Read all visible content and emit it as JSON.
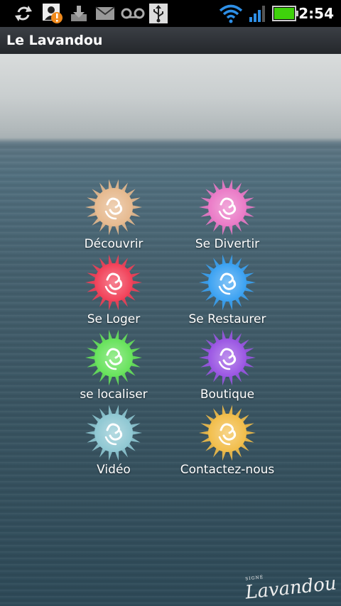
{
  "status_bar": {
    "time": "2:54",
    "icons": [
      "sync-icon",
      "account-alert-icon",
      "download-icon",
      "email-icon",
      "voicemail-icon",
      "usb-icon",
      "wifi-icon",
      "signal-icon",
      "battery-icon"
    ],
    "battery_color": "#3fd20c"
  },
  "title_bar": {
    "title": "Le Lavandou"
  },
  "menu": {
    "items": [
      {
        "label": "Découvrir",
        "color": "#e6b98e",
        "icon": "sun-logo-icon"
      },
      {
        "label": "Se Divertir",
        "color": "#ea79c6",
        "icon": "sun-logo-icon"
      },
      {
        "label": "Se Loger",
        "color": "#f13f57",
        "icon": "sun-logo-icon"
      },
      {
        "label": "Se Restaurer",
        "color": "#3aa1f2",
        "icon": "sun-logo-icon"
      },
      {
        "label": "se localiser",
        "color": "#66e25a",
        "icon": "sun-logo-icon"
      },
      {
        "label": "Boutique",
        "color": "#9a55e3",
        "icon": "sun-logo-icon"
      },
      {
        "label": "Vidéo",
        "color": "#8ec7d2",
        "icon": "sun-logo-icon"
      },
      {
        "label": "Contactez-nous",
        "color": "#f2bd49",
        "icon": "sun-logo-icon"
      }
    ]
  },
  "signature": {
    "small": "SIGNÉ",
    "text": "Lavandou"
  }
}
